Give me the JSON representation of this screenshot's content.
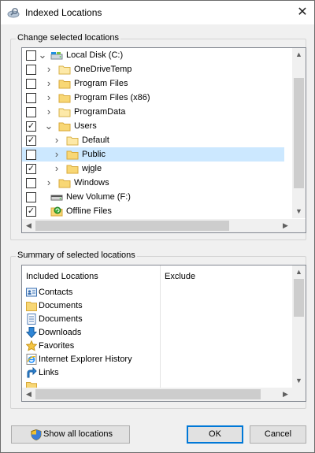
{
  "window": {
    "title": "Indexed Locations",
    "close_glyph": "✕"
  },
  "change_group": {
    "label": "Change selected locations",
    "items": [
      {
        "label": "Local Disk (C:)",
        "checked": false,
        "icon": "drive-icon"
      },
      {
        "label": "OneDriveTemp",
        "checked": false,
        "icon": "folder-icon"
      },
      {
        "label": "Program Files",
        "checked": false,
        "icon": "folder-icon"
      },
      {
        "label": "Program Files (x86)",
        "checked": false,
        "icon": "folder-icon"
      },
      {
        "label": "ProgramData",
        "checked": false,
        "icon": "folder-icon"
      },
      {
        "label": "Users",
        "checked": true,
        "icon": "folder-icon"
      },
      {
        "label": "Default",
        "checked": true,
        "icon": "folder-icon"
      },
      {
        "label": "Public",
        "checked": false,
        "icon": "folder-icon"
      },
      {
        "label": "wjgle",
        "checked": true,
        "icon": "folder-icon"
      },
      {
        "label": "Windows",
        "checked": false,
        "icon": "folder-icon"
      },
      {
        "label": "New Volume (F:)",
        "checked": false,
        "icon": "drive-icon"
      },
      {
        "label": "Offline Files",
        "checked": true,
        "icon": "offline-files-icon"
      }
    ],
    "selected_item": "Public"
  },
  "summary_group": {
    "label": "Summary of selected locations",
    "included_header": "Included Locations",
    "exclude_header": "Exclude",
    "included": [
      {
        "label": "Contacts",
        "icon": "contacts-icon"
      },
      {
        "label": "Documents",
        "icon": "folder-icon"
      },
      {
        "label": "Documents",
        "icon": "documents-icon"
      },
      {
        "label": "Downloads",
        "icon": "downloads-icon"
      },
      {
        "label": "Favorites",
        "icon": "favorites-icon"
      },
      {
        "label": "Internet Explorer History",
        "icon": "internet-explorer-icon"
      },
      {
        "label": "Links",
        "icon": "links-icon"
      }
    ]
  },
  "buttons": {
    "show_all": "Show all locations",
    "ok": "OK",
    "cancel": "Cancel"
  },
  "colors": {
    "selection": "#cce8ff",
    "accent": "#0078d7"
  }
}
